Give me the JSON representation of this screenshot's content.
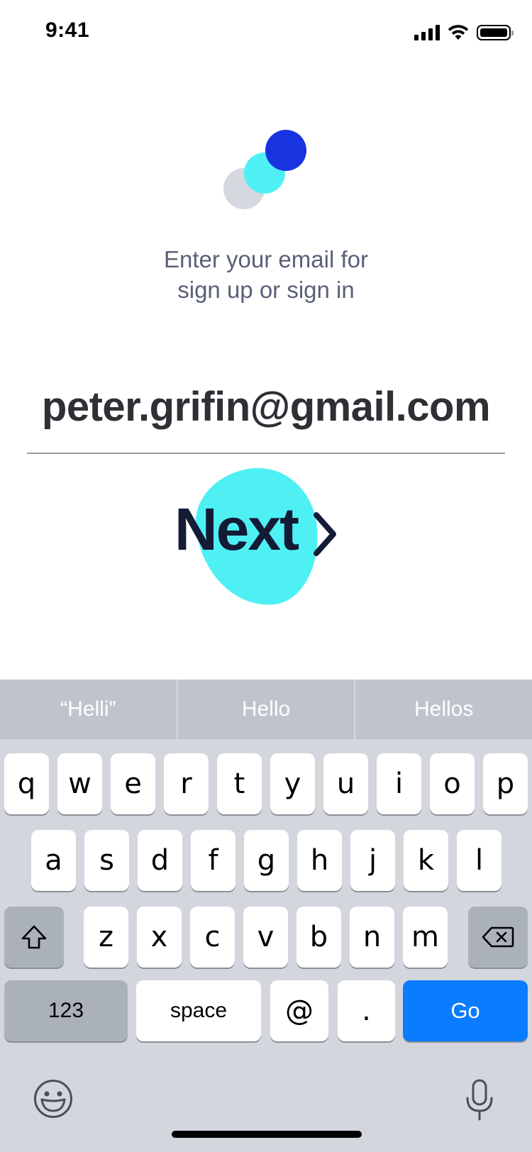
{
  "status_bar": {
    "time": "9:41",
    "icons": [
      "cellular-signal-icon",
      "wifi-icon",
      "battery-icon"
    ]
  },
  "logo": {
    "colors": [
      "#d5d8df",
      "#4ff0f4",
      "#1833e0"
    ]
  },
  "prompt": {
    "line1": "Enter your email for",
    "line2": "sign up or sign in"
  },
  "email": {
    "value": "peter.grifin@gmail.com"
  },
  "next_button": {
    "label": "Next",
    "icon": "chevron-right-icon",
    "blob_color": "#4ff0f4"
  },
  "keyboard": {
    "suggestions": [
      "“Helli”",
      "Hello",
      "Hellos"
    ],
    "row1": [
      "q",
      "w",
      "e",
      "r",
      "t",
      "y",
      "u",
      "i",
      "o",
      "p"
    ],
    "row2": [
      "a",
      "s",
      "d",
      "f",
      "g",
      "h",
      "j",
      "k",
      "l"
    ],
    "row3": [
      "z",
      "x",
      "c",
      "v",
      "b",
      "n",
      "m"
    ],
    "numbers_label": "123",
    "space_label": "space",
    "at_label": "@",
    "dot_label": ".",
    "go_label": "Go",
    "go_color": "#0a7cff",
    "shift_icon": "shift-icon",
    "delete_icon": "backspace-icon",
    "emoji_icon": "emoji-icon",
    "mic_icon": "microphone-icon"
  }
}
